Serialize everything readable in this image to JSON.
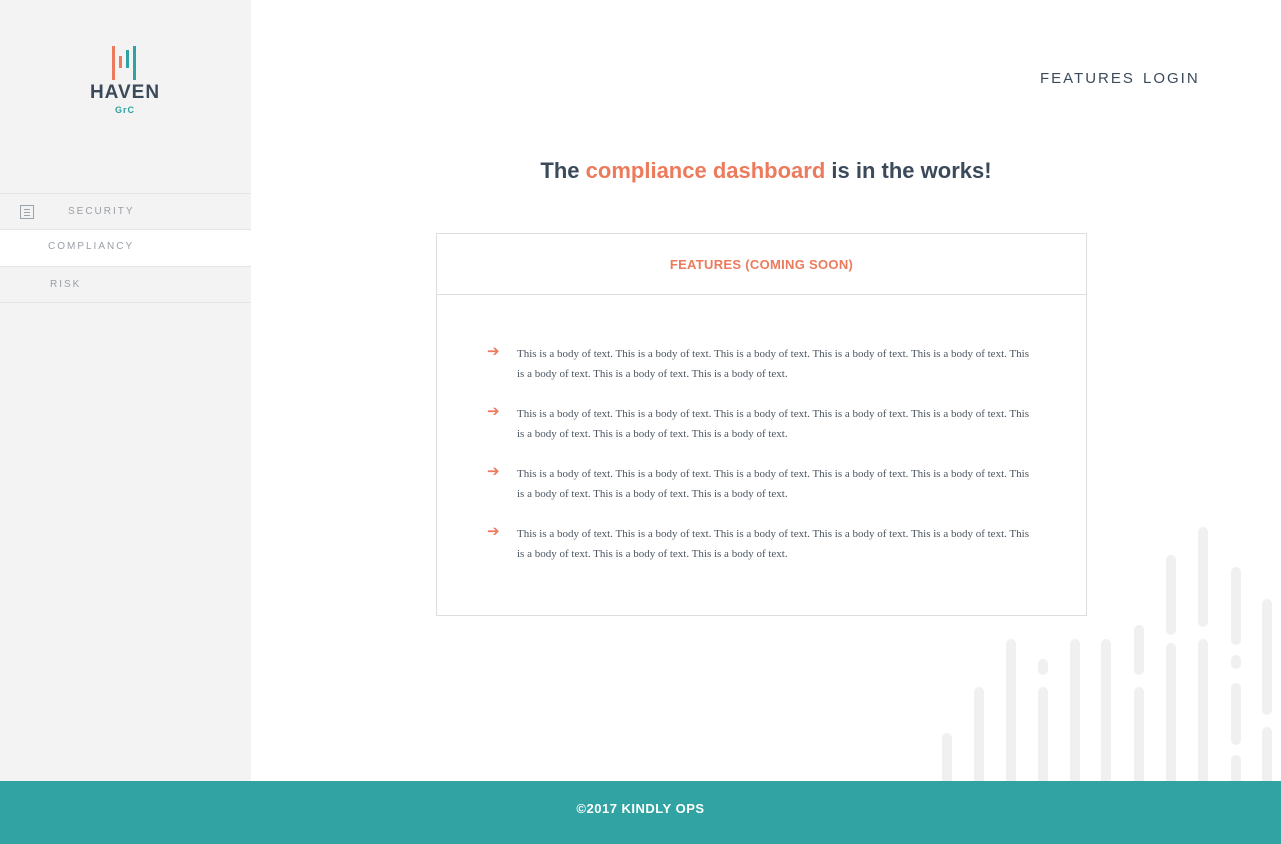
{
  "brand": {
    "name": "HAVEN",
    "sub": "GrC"
  },
  "sidebar": {
    "items": [
      {
        "label": "SECURITY",
        "icon": "document-icon"
      },
      {
        "label": "COMPLIANCY"
      },
      {
        "label": "RISK"
      }
    ]
  },
  "topnav": {
    "features": "FEATURES",
    "login": "LOGIN"
  },
  "headline": {
    "before": "The",
    "accent": "compliance dashboard",
    "after": "is in the works!"
  },
  "card": {
    "title": "FEATURES (COMING SOON)",
    "features": [
      {
        "text": "This is a body of text. This is a body of text. This is a body of text. This is a body of text. This is a body of text. This is a body of text. This is a body of text. This is a body of text."
      },
      {
        "text": "This is a body of text. This is a body of text. This is a body of text. This is a body of text. This is a body of text. This is a body of text. This is a body of text. This is a body of text."
      },
      {
        "text": "This is a body of text. This is a body of text. This is a body of text. This is a body of text. This is a body of text. This is a body of text. This is a body of text. This is a body of text."
      },
      {
        "text": "This is a body of text. This is a body of text. This is a body of text. This is a body of text. This is a body of text. This is a body of text. This is a body of text. This is a body of text."
      }
    ]
  },
  "footer": {
    "copyright": "©2017 KINDLY OPS"
  },
  "colors": {
    "accent": "#ec7a5c",
    "teal": "#31a3a2",
    "navy": "#3b4a5a"
  }
}
